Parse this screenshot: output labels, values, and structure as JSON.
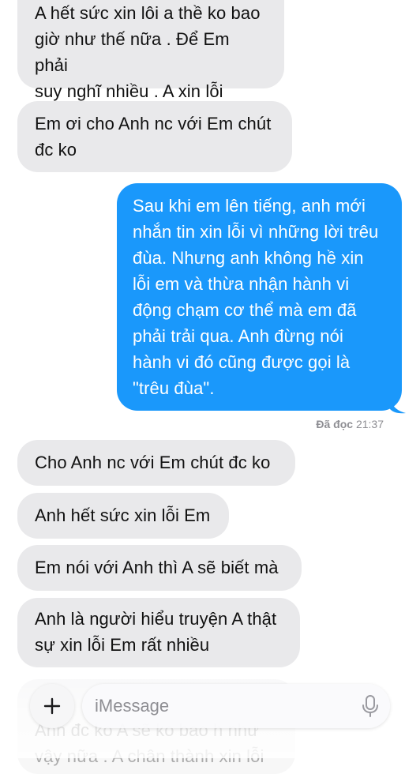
{
  "messages": {
    "m1": "A hết sức xin lôi a thề ko bao\ngiờ như thế nữa . Để Em phải\nsuy nghĩ nhiều . A xin lỗi",
    "m2": "Em ơi cho Anh nc với Em chút\nđc ko",
    "m3": "Sau khi em lên tiếng, anh mới\nnhắn tin xin lỗi vì những lời trêu\nđùa. Nhưng anh không hề xin\nlỗi em và thừa nhận hành vi\nđộng chạm cơ thể mà em đã\nphải trải qua. Anh đừng nói\nhành vi đó cũng được gọi là\n\"trêu đùa\".",
    "m4": "Cho Anh nc với Em chút đc ko",
    "m5": "Anh hết sức xin lỗi Em",
    "m6": "Em nói với Anh thì A sẽ biết mà",
    "m7": "Anh là người hiểu truyện A thật\nsự xin lỗi Em rất nhiều",
    "m8": "Anh đc ko A sẽ ko bao h như\nvậy nữa . A chân thành xin lỗi"
  },
  "read_receipt": {
    "label": "Đã đọc",
    "time": "21:37"
  },
  "composer": {
    "placeholder": "iMessage",
    "plus_icon": "plus-icon",
    "mic_icon": "microphone-icon"
  },
  "colors": {
    "incoming": "#e9e9eb",
    "outgoing": "#1a98fb",
    "meta": "#8e8e93"
  }
}
